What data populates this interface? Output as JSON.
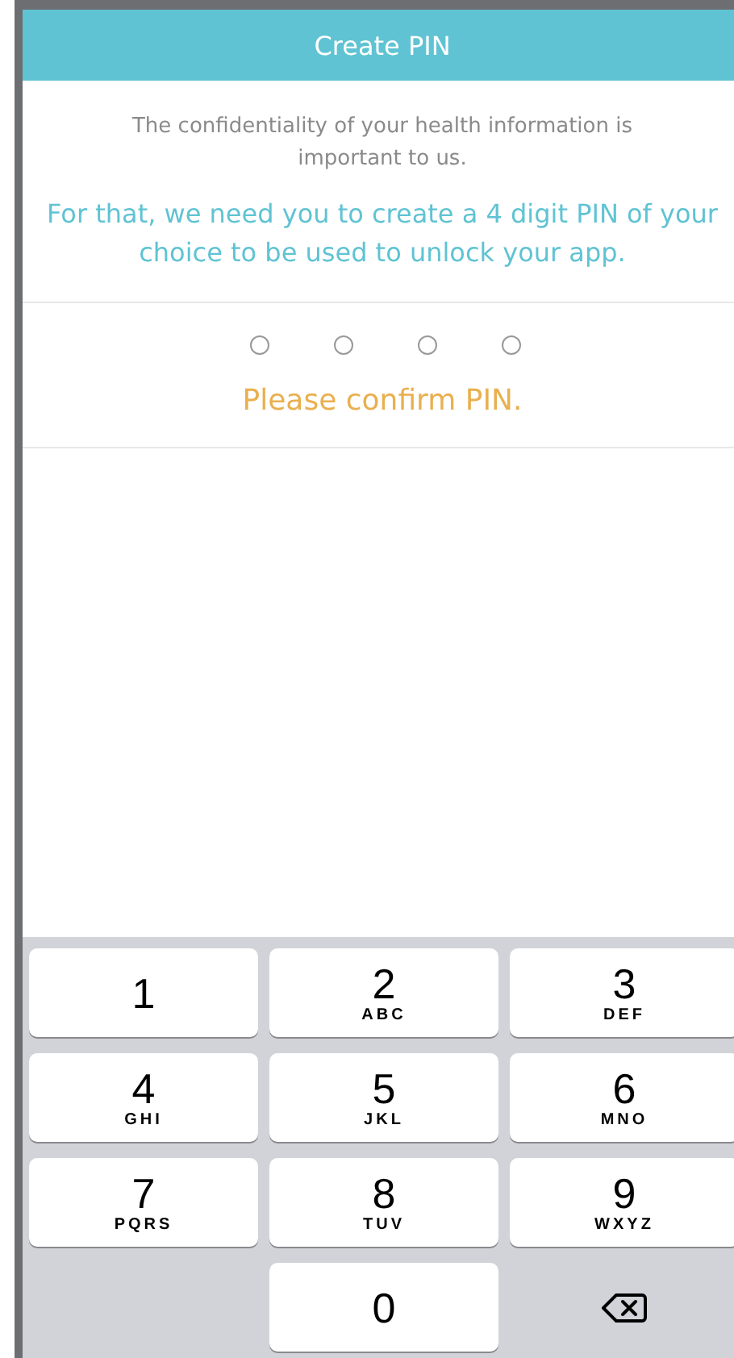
{
  "header": {
    "title": "Create PIN"
  },
  "intro": "The confidentiality of your health information is important to us.",
  "instruction": "For that, we need you to create a 4 digit PIN of your choice to be used to unlock your app.",
  "pin_dots": [
    {
      "filled": false
    },
    {
      "filled": false
    },
    {
      "filled": false
    },
    {
      "filled": false
    }
  ],
  "prompt": "Please confirm PIN.",
  "keypad": [
    {
      "kind": "digit",
      "digit": "1"
    },
    {
      "kind": "digit",
      "digit": "2",
      "letters": "ABC"
    },
    {
      "kind": "digit",
      "digit": "3",
      "letters": "DEF"
    },
    {
      "kind": "digit",
      "digit": "4",
      "letters": "GHI"
    },
    {
      "kind": "digit",
      "digit": "5",
      "letters": "JKL"
    },
    {
      "kind": "digit",
      "digit": "6",
      "letters": "MNO"
    },
    {
      "kind": "digit",
      "digit": "7",
      "letters": "PQRS"
    },
    {
      "kind": "digit",
      "digit": "8",
      "letters": "TUV"
    },
    {
      "kind": "digit",
      "digit": "9",
      "letters": "WXYZ"
    },
    {
      "kind": "blank"
    },
    {
      "kind": "digit",
      "digit": "0"
    },
    {
      "kind": "delete"
    }
  ]
}
